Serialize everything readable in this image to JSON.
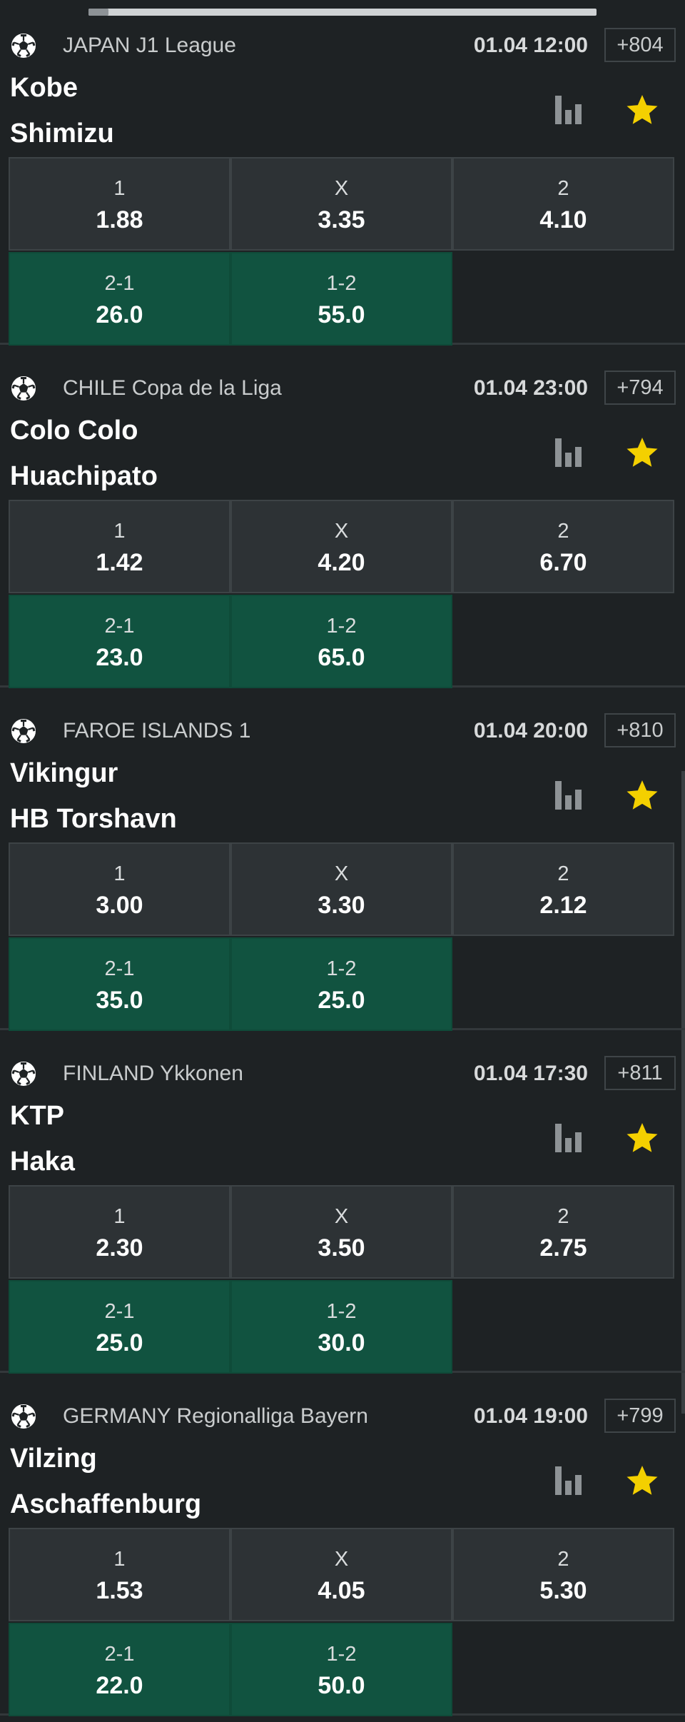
{
  "events": [
    {
      "league": "JAPAN J1 League",
      "datetime": "01.04 12:00",
      "more_markets": "+804",
      "home": "Kobe",
      "away": "Shimizu",
      "odds": [
        {
          "label": "1",
          "value": "1.88"
        },
        {
          "label": "X",
          "value": "3.35"
        },
        {
          "label": "2",
          "value": "4.10"
        }
      ],
      "combos": [
        {
          "label": "2-1",
          "value": "26.0"
        },
        {
          "label": "1-2",
          "value": "55.0"
        }
      ]
    },
    {
      "league": "CHILE Copa de la Liga",
      "datetime": "01.04 23:00",
      "more_markets": "+794",
      "home": "Colo Colo",
      "away": "Huachipato",
      "odds": [
        {
          "label": "1",
          "value": "1.42"
        },
        {
          "label": "X",
          "value": "4.20"
        },
        {
          "label": "2",
          "value": "6.70"
        }
      ],
      "combos": [
        {
          "label": "2-1",
          "value": "23.0"
        },
        {
          "label": "1-2",
          "value": "65.0"
        }
      ]
    },
    {
      "league": "FAROE ISLANDS 1",
      "datetime": "01.04 20:00",
      "more_markets": "+810",
      "home": "Vikingur",
      "away": "HB Torshavn",
      "odds": [
        {
          "label": "1",
          "value": "3.00"
        },
        {
          "label": "X",
          "value": "3.30"
        },
        {
          "label": "2",
          "value": "2.12"
        }
      ],
      "combos": [
        {
          "label": "2-1",
          "value": "35.0"
        },
        {
          "label": "1-2",
          "value": "25.0"
        }
      ]
    },
    {
      "league": "FINLAND Ykkonen",
      "datetime": "01.04 17:30",
      "more_markets": "+811",
      "home": "KTP",
      "away": "Haka",
      "odds": [
        {
          "label": "1",
          "value": "2.30"
        },
        {
          "label": "X",
          "value": "3.50"
        },
        {
          "label": "2",
          "value": "2.75"
        }
      ],
      "combos": [
        {
          "label": "2-1",
          "value": "25.0"
        },
        {
          "label": "1-2",
          "value": "30.0"
        }
      ]
    },
    {
      "league": "GERMANY Regionalliga Bayern",
      "datetime": "01.04 19:00",
      "more_markets": "+799",
      "home": "Vilzing",
      "away": "Aschaffenburg",
      "odds": [
        {
          "label": "1",
          "value": "1.53"
        },
        {
          "label": "X",
          "value": "4.05"
        },
        {
          "label": "2",
          "value": "5.30"
        }
      ],
      "combos": [
        {
          "label": "2-1",
          "value": "22.0"
        },
        {
          "label": "1-2",
          "value": "50.0"
        }
      ]
    }
  ],
  "icons": {
    "sport": "soccer-ball-icon",
    "stats": "bar-chart-icon",
    "favorite": "star-icon"
  },
  "colors": {
    "background": "#1e2224",
    "odds_cell": "#2d3235",
    "combo_cell": "#115340",
    "star": "#f4d000",
    "stats_icon": "#8e9396"
  }
}
